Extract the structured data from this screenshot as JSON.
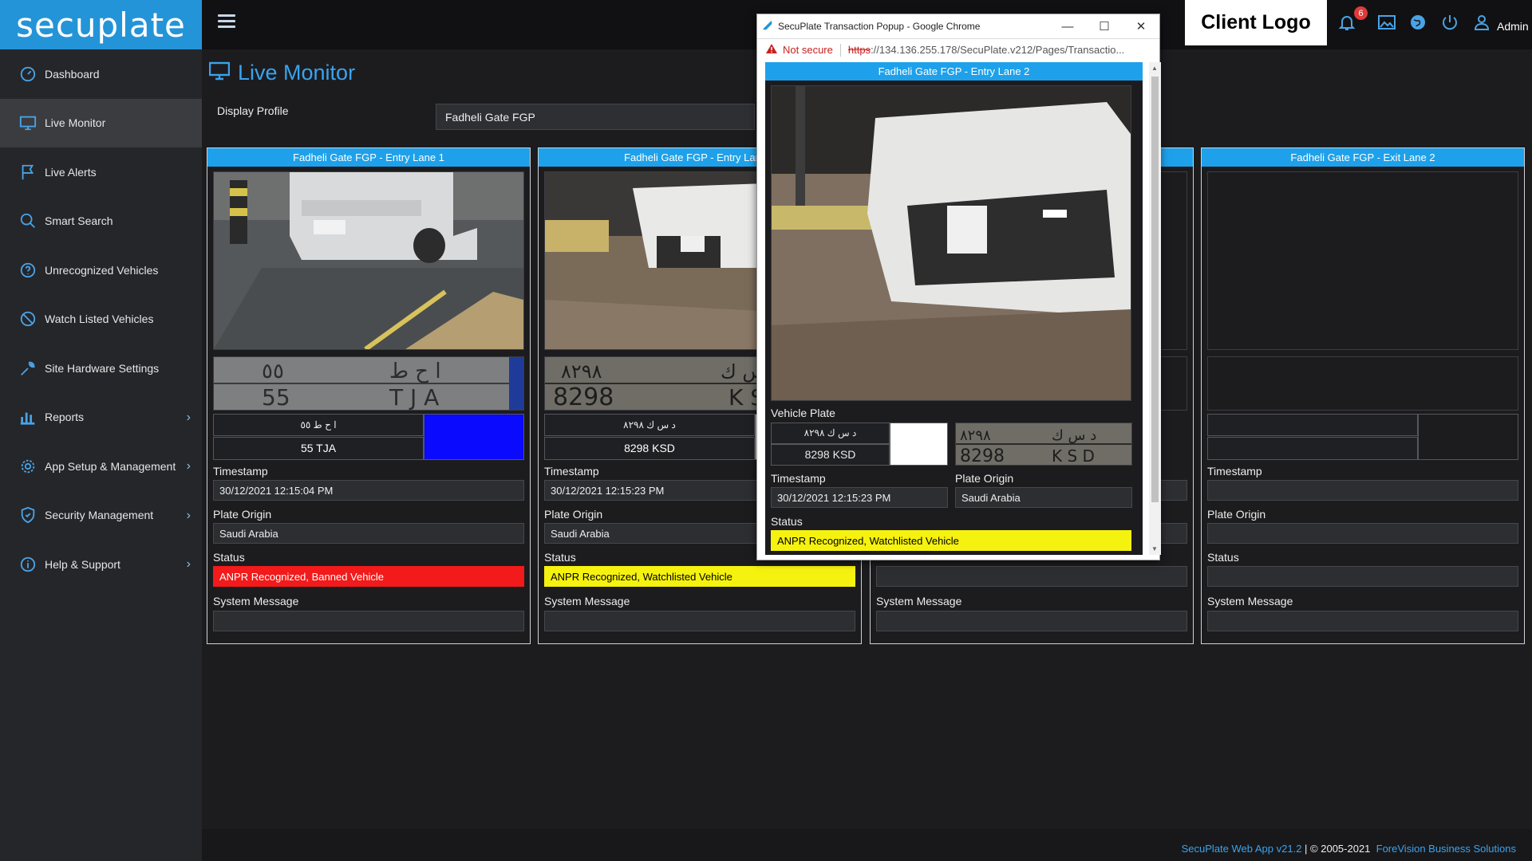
{
  "app": {
    "logo_text": "secuplate",
    "client_logo": "Client Logo",
    "notification_count": "6",
    "user_label": "Admin",
    "footer": {
      "version": "SecuPlate Web App v21.2",
      "separator": " | ",
      "copyright": "© 2005-2021",
      "company": "ForeVision Business Solutions"
    }
  },
  "header_icons": [
    "menu-icon",
    "bell-icon",
    "image-icon",
    "globe-icon",
    "power-icon",
    "user-icon"
  ],
  "sidebar": {
    "items": [
      {
        "label": "Dashboard",
        "icon": "dashboard-icon",
        "has_submenu": false
      },
      {
        "label": "Live Monitor",
        "icon": "monitor-icon",
        "has_submenu": false,
        "active": true
      },
      {
        "label": "Live Alerts",
        "icon": "flag-icon",
        "has_submenu": false
      },
      {
        "label": "Smart Search",
        "icon": "search-icon",
        "has_submenu": false
      },
      {
        "label": "Unrecognized Vehicles",
        "icon": "question-icon",
        "has_submenu": false
      },
      {
        "label": "Watch Listed Vehicles",
        "icon": "ban-icon",
        "has_submenu": false
      },
      {
        "label": "Site Hardware Settings",
        "icon": "wrench-icon",
        "has_submenu": false
      },
      {
        "label": "Reports",
        "icon": "chart-icon",
        "has_submenu": true
      },
      {
        "label": "App Setup & Management",
        "icon": "gear-icon",
        "has_submenu": true
      },
      {
        "label": "Security Management",
        "icon": "shield-icon",
        "has_submenu": true
      },
      {
        "label": "Help & Support",
        "icon": "info-icon",
        "has_submenu": true
      }
    ]
  },
  "main": {
    "title": "Live Monitor",
    "display_profile_label": "Display Profile",
    "display_profile_value": "Fadheli Gate FGP",
    "field_labels": {
      "timestamp": "Timestamp",
      "plate_origin": "Plate Origin",
      "status": "Status",
      "system_message": "System Message",
      "vehicle_plate": "Vehicle Plate"
    },
    "lanes": [
      {
        "name": "Fadheli Gate FGP - Entry Lane 1",
        "plate_ar": "ا ح ط ٥٥",
        "plate_en": "55 TJA",
        "plate_color": "#0a0aff",
        "timestamp": "30/12/2021 12:15:04 PM",
        "origin": "Saudi Arabia",
        "status": "ANPR Recognized, Banned Vehicle",
        "status_color": "#f21a1a",
        "status_text_color": "#ffffff",
        "system_message": ""
      },
      {
        "name": "Fadheli Gate FGP - Entry Lane 2",
        "plate_ar": "د س ك ٨٢٩٨",
        "plate_en": "8298 KSD",
        "plate_color": "#ffffff",
        "timestamp": "30/12/2021 12:15:23 PM",
        "origin": "Saudi Arabia",
        "status": "ANPR Recognized, Watchlisted Vehicle",
        "status_color": "#f6f20f",
        "status_text_color": "#000000",
        "system_message": ""
      },
      {
        "name": "",
        "plate_ar": "",
        "plate_en": "",
        "plate_color": "",
        "timestamp": "",
        "origin": "",
        "status": "",
        "status_color": "",
        "status_text_color": "",
        "system_message": ""
      },
      {
        "name": "Fadheli Gate FGP - Exit Lane 2",
        "plate_ar": "",
        "plate_en": "",
        "plate_color": "",
        "timestamp": "",
        "origin": "",
        "status": "",
        "status_color": "",
        "status_text_color": "",
        "system_message": ""
      }
    ]
  },
  "popup": {
    "window_title": "SecuPlate Transaction Popup - Google Chrome",
    "not_secure": "Not secure",
    "url_scheme": "https",
    "url_rest": "://134.136.255.178/SecuPlate.v212/Pages/Transactio...",
    "lane_name": "Fadheli Gate FGP - Entry Lane 2",
    "plate_ar": "د س ك ٨٢٩٨",
    "plate_en": "8298 KSD",
    "plate_color": "#ffffff",
    "timestamp": "30/12/2021 12:15:23 PM",
    "origin": "Saudi Arabia",
    "status": "ANPR Recognized, Watchlisted Vehicle",
    "status_color": "#f6f20f"
  }
}
